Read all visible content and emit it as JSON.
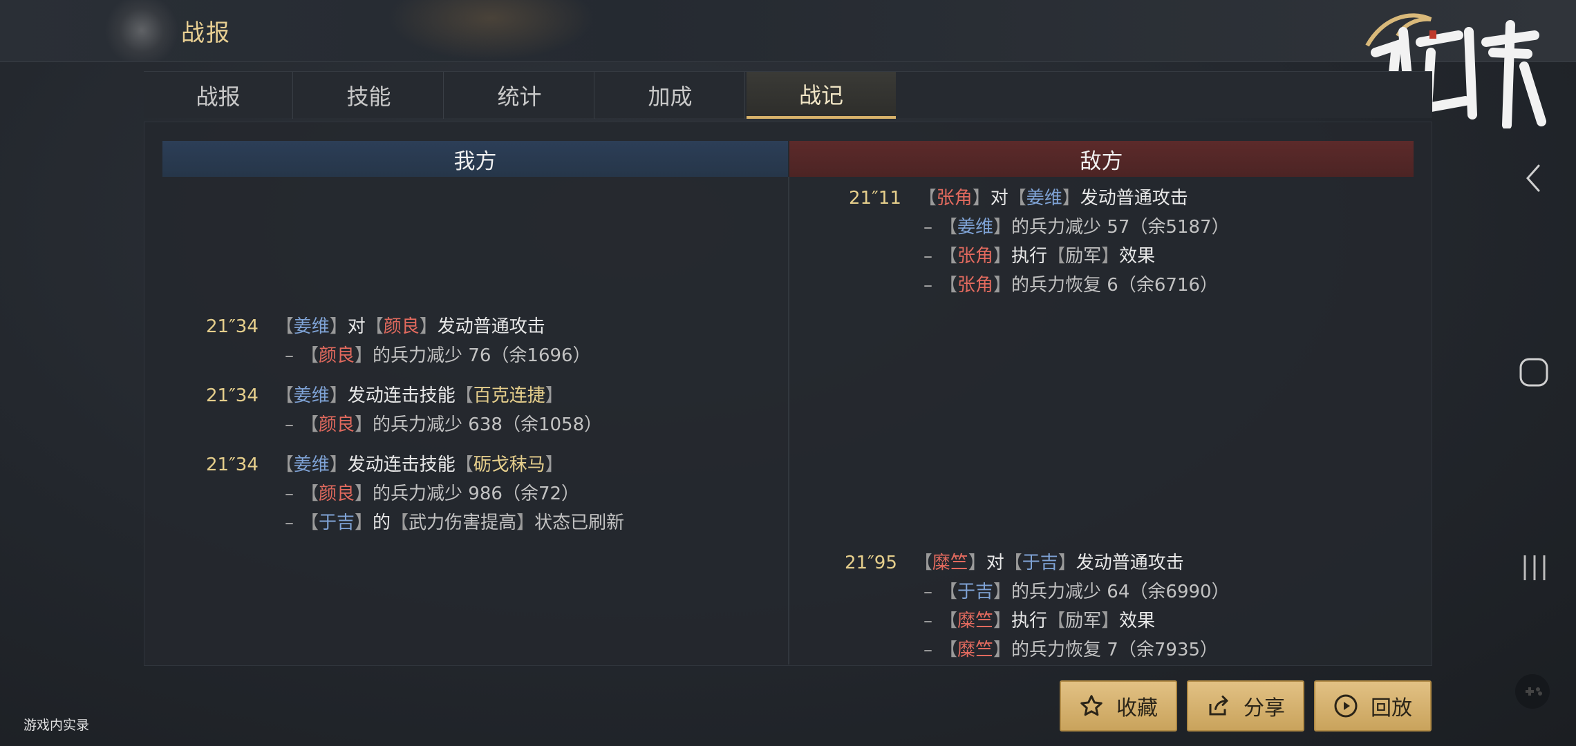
{
  "header": {
    "title": "战报",
    "logo_text": "鸿图之下"
  },
  "tabs": [
    {
      "label": "战报"
    },
    {
      "label": "技能"
    },
    {
      "label": "统计"
    },
    {
      "label": "加成"
    },
    {
      "label": "战记",
      "active": true
    }
  ],
  "columns": {
    "ours": "我方",
    "enemy": "敌方"
  },
  "enemy_log": {
    "e1": {
      "time": "21″11",
      "actor": "张角",
      "verb": "对",
      "target": "姜维",
      "action": "发动普通攻击",
      "sub1": {
        "name": "姜维",
        "text": "的兵力减少 57（余5187）"
      },
      "sub2": {
        "name": "张角",
        "pre": "执行",
        "effect": "励军",
        "post": "效果"
      },
      "sub3": {
        "name": "张角",
        "text": "的兵力恢复 6（余6716）"
      }
    },
    "e2": {
      "time": "21″95",
      "actor": "糜竺",
      "verb": "对",
      "target": "于吉",
      "action": "发动普通攻击",
      "sub1": {
        "name": "于吉",
        "text": "的兵力减少 64（余6990）"
      },
      "sub2": {
        "name": "糜竺",
        "pre": "执行",
        "effect": "励军",
        "post": "效果"
      },
      "sub3": {
        "name": "糜竺",
        "text": "的兵力恢复 7（余7935）"
      }
    }
  },
  "our_log": {
    "o1": {
      "time": "21″34",
      "actor": "姜维",
      "verb": "对",
      "target": "颜良",
      "action": "发动普通攻击",
      "sub1": {
        "name": "颜良",
        "text": "的兵力减少 76（余1696）"
      }
    },
    "o2": {
      "time": "21″34",
      "actor": "姜维",
      "action": "发动连击技能",
      "skill": "百克连捷",
      "sub1": {
        "name": "颜良",
        "text": "的兵力减少 638（余1058）"
      }
    },
    "o3": {
      "time": "21″34",
      "actor": "姜维",
      "action": "发动连击技能",
      "skill": "砺戈秣马",
      "sub1": {
        "name": "颜良",
        "text": "的兵力减少 986（余72）"
      },
      "sub2": {
        "name": "于吉",
        "pre": "的",
        "status": "武力伤害提高",
        "post": "状态已刷新"
      }
    }
  },
  "buttons": {
    "favorite": "收藏",
    "share": "分享",
    "replay": "回放"
  },
  "watermark": "游戏内实录",
  "colors": {
    "accent_gold": "#e6cf8c",
    "our_side": "#2c3e57",
    "enemy_side": "#5c2a2a",
    "button": "#d8b674"
  }
}
